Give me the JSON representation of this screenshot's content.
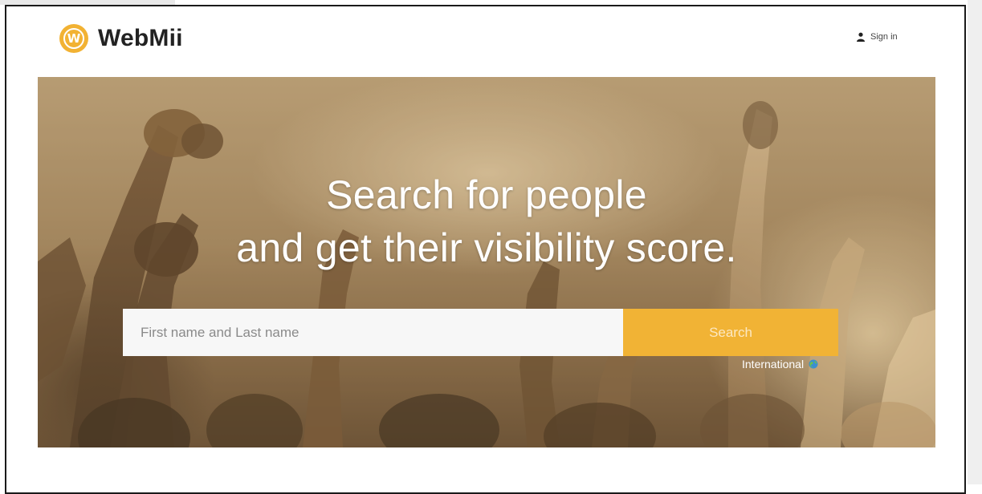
{
  "header": {
    "logo_letter": "W",
    "brand": "WebMii",
    "signin_label": "Sign in",
    "signin_icon": "user-icon"
  },
  "hero": {
    "headline_line1": "Search for people",
    "headline_line2": "and get their visibility score."
  },
  "search": {
    "placeholder": "First name and Last name",
    "value": "",
    "button_label": "Search"
  },
  "locale": {
    "label": "International",
    "icon": "globe-icon"
  },
  "colors": {
    "accent": "#f1b335",
    "brand_text": "#222222",
    "hero_text": "#ffffff"
  }
}
